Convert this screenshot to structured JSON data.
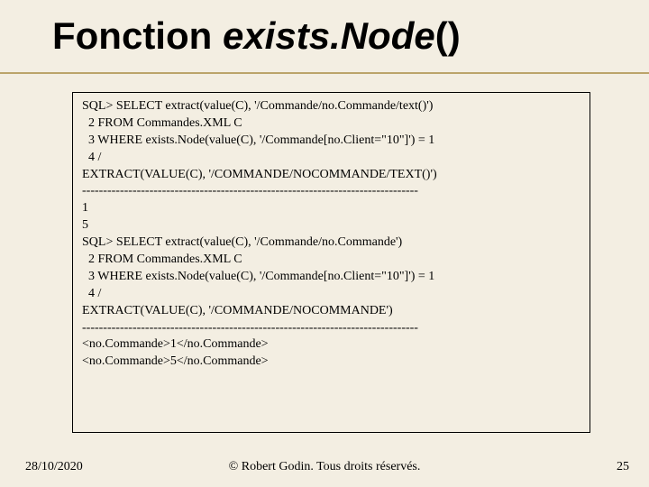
{
  "title": {
    "left": "Fonction ",
    "italic": "exists.Node",
    "right": "()"
  },
  "code": {
    "l01": "SQL> SELECT extract(value(C), '/Commande/no.Commande/text()')",
    "l02": "  2 FROM Commandes.XML C",
    "l03": "  3 WHERE exists.Node(value(C), '/Commande[no.Client=\"10\"]') = 1",
    "l04": "  4 /",
    "l05": "",
    "l06": "EXTRACT(VALUE(C), '/COMMANDE/NOCOMMANDE/TEXT()')",
    "l07": "--------------------------------------------------------------------------------",
    "l08": "1",
    "l09": "5",
    "l10": "",
    "l11": "SQL> SELECT extract(value(C), '/Commande/no.Commande')",
    "l12": "  2 FROM Commandes.XML C",
    "l13": "  3 WHERE exists.Node(value(C), '/Commande[no.Client=\"10\"]') = 1",
    "l14": "  4 /",
    "l15": "",
    "l16": "EXTRACT(VALUE(C), '/COMMANDE/NOCOMMANDE')",
    "l17": "--------------------------------------------------------------------------------",
    "l18": "<no.Commande>1</no.Commande>",
    "l19": "<no.Commande>5</no.Commande>"
  },
  "footer": {
    "date": "28/10/2020",
    "copyright": "© Robert Godin. Tous droits réservés.",
    "pagenum": "25"
  }
}
